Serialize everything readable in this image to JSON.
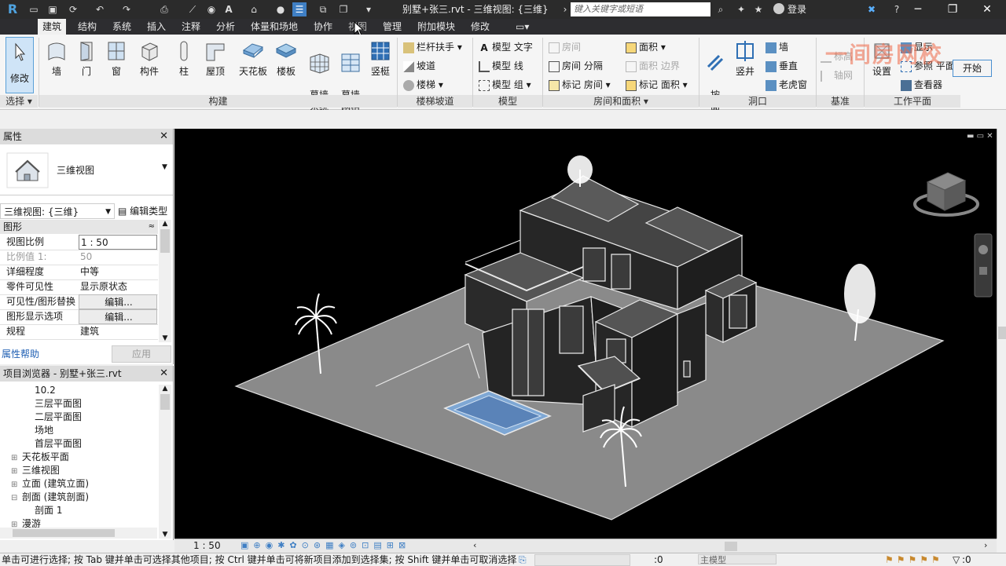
{
  "window": {
    "title": "别墅+张三.rvt - 三维视图: {三维}",
    "search_placeholder": "键入关键字或短语",
    "login": "登录",
    "minimize": "─",
    "maximize": "❐",
    "close": "✕"
  },
  "tabs": [
    {
      "label": "建筑",
      "active": true
    },
    {
      "label": "结构"
    },
    {
      "label": "系统"
    },
    {
      "label": "插入"
    },
    {
      "label": "注释"
    },
    {
      "label": "分析"
    },
    {
      "label": "体量和场地"
    },
    {
      "label": "协作"
    },
    {
      "label": "视图"
    },
    {
      "label": "管理"
    },
    {
      "label": "附加模块"
    },
    {
      "label": "修改"
    }
  ],
  "ribbon": {
    "modify": "修改",
    "select_panel": "选择",
    "build_panel": "构建",
    "build_tools": [
      "墙",
      "门",
      "窗",
      "构件",
      "柱",
      "屋顶",
      "天花板",
      "楼板",
      "幕墙\n系统",
      "幕墙\n网格",
      "竖梃"
    ],
    "stairs_panel": "楼梯坡道",
    "stairs_tools": [
      "栏杆扶手",
      "坡道",
      "楼梯"
    ],
    "model_panel": "模型",
    "model_tools": [
      "模型 文字",
      "模型 线",
      "模型 组"
    ],
    "room_panel": "房间和面积",
    "room_tools": [
      "房间",
      "房间 分隔",
      "标记 房间",
      "面积",
      "面积 边界",
      "标记 面积"
    ],
    "opening_panel": "洞口",
    "opening_tools": [
      "按\n面",
      "竖井",
      "墙",
      "垂直",
      "老虎窗"
    ],
    "datum_panel": "基准",
    "datum_tools": [
      "标高",
      "轴网"
    ],
    "workplane_panel": "工作平面",
    "workplane_tools": [
      "设置",
      "显示",
      "参照 平面",
      "查看器"
    ],
    "start_button": "开始",
    "watermark": "一间房网校"
  },
  "properties": {
    "title": "属性",
    "type_name": "三维视图",
    "selector": "三维视图: {三维}",
    "edit_type": "编辑类型",
    "group": "图形",
    "rows": [
      {
        "k": "视图比例",
        "v": "1 : 50"
      },
      {
        "k": "比例值 1:",
        "v": "50"
      },
      {
        "k": "详细程度",
        "v": "中等"
      },
      {
        "k": "零件可见性",
        "v": "显示原状态"
      },
      {
        "k": "可见性/图形替换",
        "v": "编辑..."
      },
      {
        "k": "图形显示选项",
        "v": "编辑..."
      },
      {
        "k": "规程",
        "v": "建筑"
      }
    ],
    "help": "属性帮助",
    "apply": "应用"
  },
  "browser": {
    "title": "项目浏览器 - 别墅+张三.rvt",
    "items": [
      {
        "label": "10.2",
        "indent": 2
      },
      {
        "label": "三层平面图",
        "indent": 2
      },
      {
        "label": "二层平面图",
        "indent": 2
      },
      {
        "label": "场地",
        "indent": 2
      },
      {
        "label": "首层平面图",
        "indent": 2
      },
      {
        "label": "天花板平面",
        "indent": 1,
        "exp": "⊞"
      },
      {
        "label": "三维视图",
        "indent": 1,
        "exp": "⊞"
      },
      {
        "label": "立面 (建筑立面)",
        "indent": 1,
        "exp": "⊞"
      },
      {
        "label": "剖面 (建筑剖面)",
        "indent": 1,
        "exp": "⊟"
      },
      {
        "label": "剖面 1",
        "indent": 2
      },
      {
        "label": "漫游",
        "indent": 1,
        "exp": "⊞"
      }
    ]
  },
  "viewbar": {
    "scale": "1 : 50"
  },
  "status": {
    "text": "单击可进行选择; 按 Tab 键并单击可选择其他项目; 按 Ctrl 键并单击可将新项目添加到选择集; 按 Shift 键并单击可取消选择。",
    "zero": ":0",
    "model": "主模型",
    "filter": ":0"
  }
}
